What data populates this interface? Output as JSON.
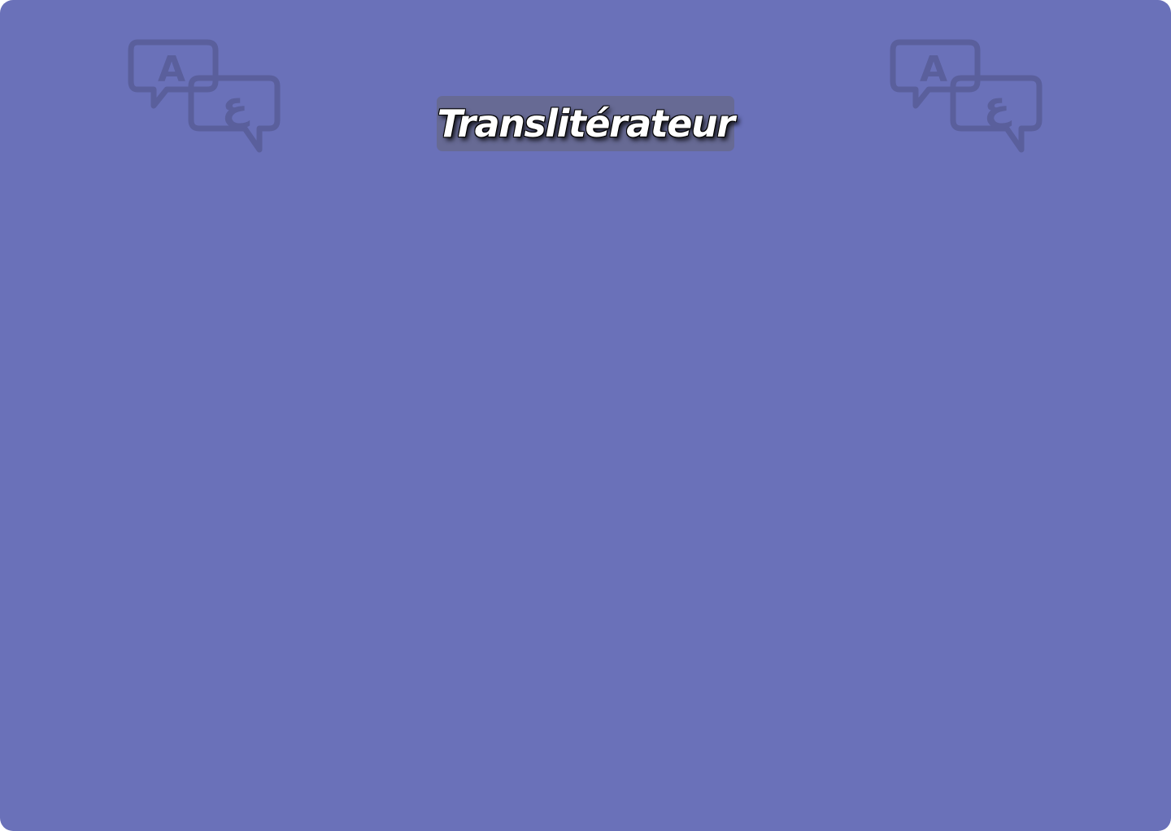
{
  "app": {
    "title": "Translitérateur"
  },
  "theme": {
    "background": "#6a71b9",
    "title_box": "#676a94",
    "icon_color": "#5a5f9c"
  },
  "icons": {
    "left": "translate-chat-icon",
    "right": "translate-chat-icon",
    "latin_glyph": "A",
    "arabic_glyph": "ع"
  }
}
